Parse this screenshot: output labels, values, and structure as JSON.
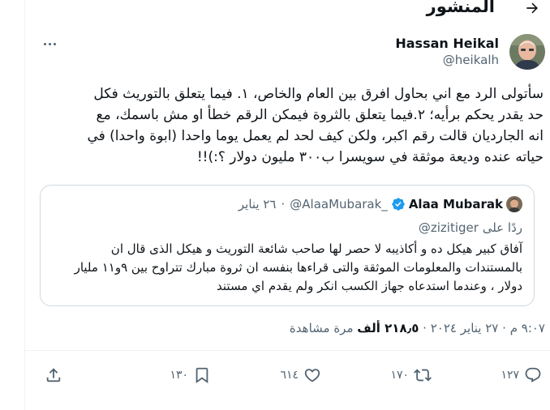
{
  "header": {
    "title": "المنشور",
    "back_icon": "arrow-left-icon"
  },
  "author": {
    "name": "Hassan Heikal",
    "handle": "@heikalh"
  },
  "tweet": {
    "text": "سأتولى الرد مع اني بحاول افرق بين العام والخاص، ١. فيما يتعلق بالتوريث فكل\nحد يقدر يحكم برأيه؛ ٢.فيما يتعلق بالثروة فيمكن الرقم خطأ او مش باسمك، مع\nانه الجارديان قالت رقم اكبر، ولكن كيف لحد لم يعمل يوما واحدا (ابوة واحدا) في\nحياته عنده وديعة موثقة في سويسرا ب٣٠٠ مليون دولار ؟:)!!"
  },
  "quote": {
    "name": "Alaa Mubarak",
    "handle": "@AlaaMubarak_",
    "separator": "·",
    "date": "٢٦ يناير",
    "reply_prefix": "ردًا على",
    "reply_to": "@zizitiger",
    "text": "آفاق كبير هيكل ده و أكاذيبه لا حصر لها صاحب  شائعة التوريث و هيكل الذى قال ان\nبالمستندات والمعلومات الموثقة والتى قراءها بنفسه ان ثروة مبارك تتراوح بين ٩و١١ مليار\nدولار ، وعندما استدعاه جهاز الكسب انكر ولم يقدم اي مستند",
    "verified_color": "#1d9bf0"
  },
  "meta": {
    "time": "٩:٠٧ م",
    "separator": "·",
    "date": "٢٧ يناير ٢٠٢٤",
    "views_count": "٢١٨٫٥ ألف",
    "views_label": "مرة مشاهدة"
  },
  "actions": {
    "reply_count": "١٢٧",
    "retweet_count": "١٧٠",
    "like_count": "٦١٤",
    "bookmark_count": "١٣٠"
  }
}
